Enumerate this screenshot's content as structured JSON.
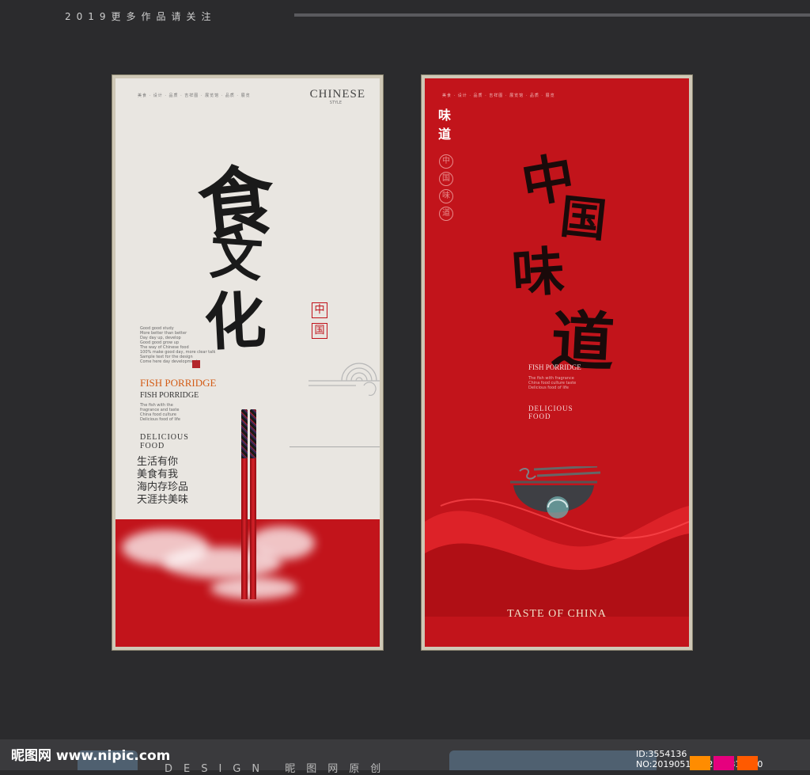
{
  "header": {
    "caption": "2019更多作品请关注"
  },
  "left_poster": {
    "top_tags": "美食 · 设计 · 品质 · 吉祥图 · 展览馆 · 品质 · 展览",
    "brand": "CHINESE",
    "brand_sub": "STYLE",
    "callig_1": "食",
    "callig_2": "文",
    "callig_3": "化",
    "seal_1": "中",
    "seal_2": "国",
    "body_text_1": "Good good study\nMore better than better\nDay day up, develop\nGood good grow up\nThe way of Chinese food",
    "body_text_2": "100% make good day, more clear talk\nSample text for the design\nCome here day development",
    "fish_orange": "FISH PORRIDGE",
    "fish_dark": "FISH PORRIDGE",
    "body_text_3": "The fish with the\nfragrance and taste\nChina food culture\nDelicious food of life",
    "delicious_1": "DELICIOUS",
    "delicious_2": "FOOD",
    "poem_1": "生活有你",
    "poem_2": "美食有我",
    "poem_3": "海内存珍品",
    "poem_4": "天涯共美味"
  },
  "right_poster": {
    "top_tags": "美食 · 设计 · 品质 · 吉祥图 · 展览馆 · 品质 · 展览",
    "vert_1": "味",
    "vert_2": "道",
    "circle_1": "中",
    "circle_2": "国",
    "circle_3": "味",
    "circle_4": "道",
    "callig_1": "中",
    "callig_2": "国",
    "callig_3": "味",
    "callig_4": "道",
    "fish": "FISH PORRIDGE",
    "small_text": "The fish with fragrance\nChina food culture taste\nDelicious food of life",
    "delicious_1": "DELICIOUS",
    "delicious_2": "FOOD",
    "taste": "TASTE OF CHINA"
  },
  "footer": {
    "logo": "昵图网 www.nipic.com",
    "design": "DESIGN 昵图网原创",
    "id": "ID:3554136 NO:20190510102534811000"
  },
  "colors": {
    "red": "#c2141b",
    "orange": "#d35c16",
    "swatch_1": "#ff8c00",
    "swatch_2": "#e6007e",
    "swatch_3": "#ff5a00"
  }
}
